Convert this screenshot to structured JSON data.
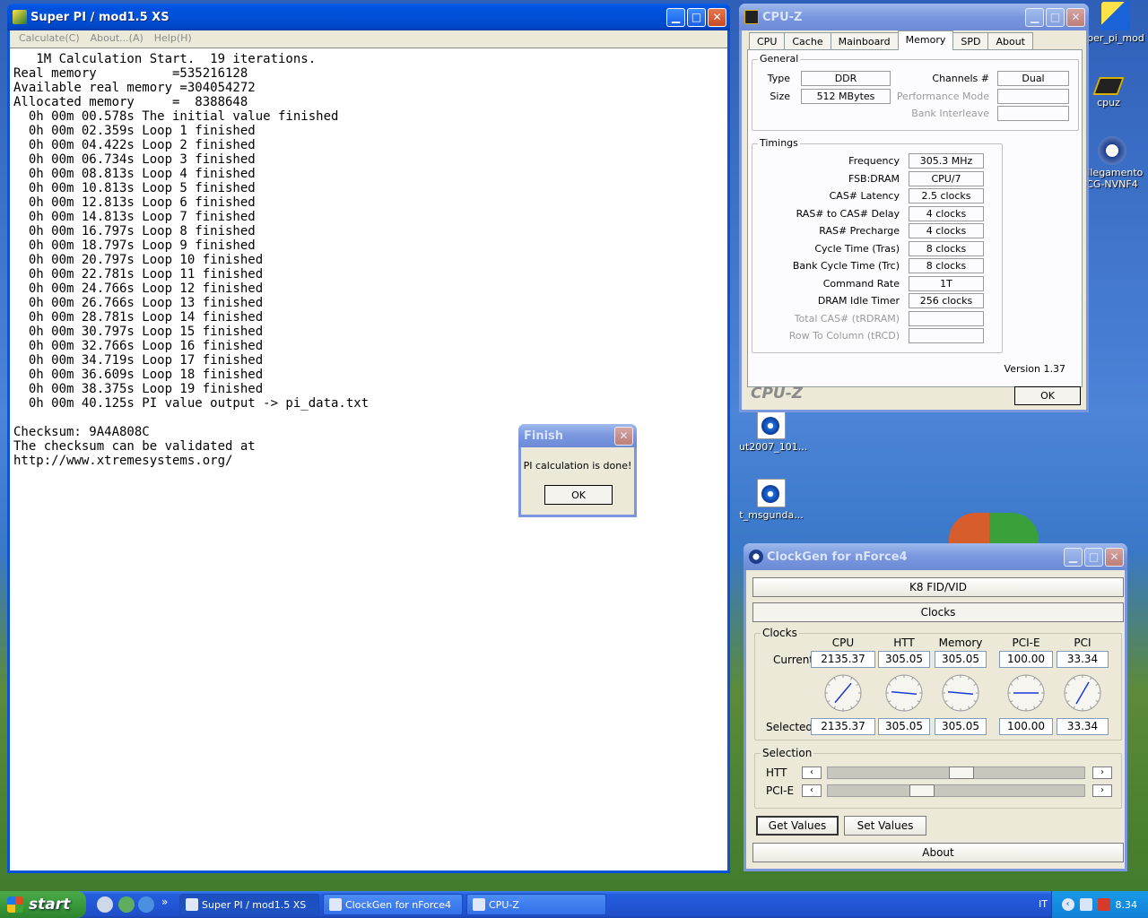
{
  "superpi": {
    "title": "Super PI / mod1.5 XS",
    "menu": [
      "Calculate(C)",
      "About...(A)",
      "Help(H)"
    ],
    "lines": [
      "   1M Calculation Start.  19 iterations.",
      "Real memory          =535216128",
      "Available real memory =304054272",
      "Allocated memory     =  8388648",
      "  0h 00m 00.578s The initial value finished",
      "  0h 00m 02.359s Loop 1 finished",
      "  0h 00m 04.422s Loop 2 finished",
      "  0h 00m 06.734s Loop 3 finished",
      "  0h 00m 08.813s Loop 4 finished",
      "  0h 00m 10.813s Loop 5 finished",
      "  0h 00m 12.813s Loop 6 finished",
      "  0h 00m 14.813s Loop 7 finished",
      "  0h 00m 16.797s Loop 8 finished",
      "  0h 00m 18.797s Loop 9 finished",
      "  0h 00m 20.797s Loop 10 finished",
      "  0h 00m 22.781s Loop 11 finished",
      "  0h 00m 24.766s Loop 12 finished",
      "  0h 00m 26.766s Loop 13 finished",
      "  0h 00m 28.781s Loop 14 finished",
      "  0h 00m 30.797s Loop 15 finished",
      "  0h 00m 32.766s Loop 16 finished",
      "  0h 00m 34.719s Loop 17 finished",
      "  0h 00m 36.609s Loop 18 finished",
      "  0h 00m 38.375s Loop 19 finished",
      "  0h 00m 40.125s PI value output -> pi_data.txt",
      "",
      "Checksum: 9A4A808C",
      "The checksum can be validated at",
      "http://www.xtremesystems.org/"
    ]
  },
  "finish": {
    "title": "Finish",
    "message": "PI calculation is done!",
    "ok": "OK"
  },
  "cpuz": {
    "title": "CPU-Z",
    "tabs": [
      "CPU",
      "Cache",
      "Mainboard",
      "Memory",
      "SPD",
      "About"
    ],
    "active_tab": "Memory",
    "general": {
      "legend": "General",
      "type_label": "Type",
      "type": "DDR",
      "size_label": "Size",
      "size": "512 MBytes",
      "channels_label": "Channels #",
      "channels": "Dual",
      "perf_label": "Performance Mode",
      "bank_label": "Bank Interleave"
    },
    "timings": {
      "legend": "Timings",
      "rows": [
        {
          "label": "Frequency",
          "value": "305.3 MHz",
          "dim": false
        },
        {
          "label": "FSB:DRAM",
          "value": "CPU/7",
          "dim": false
        },
        {
          "label": "CAS# Latency",
          "value": "2.5 clocks",
          "dim": false
        },
        {
          "label": "RAS# to CAS# Delay",
          "value": "4 clocks",
          "dim": false
        },
        {
          "label": "RAS# Precharge",
          "value": "4 clocks",
          "dim": false
        },
        {
          "label": "Cycle Time (Tras)",
          "value": "8 clocks",
          "dim": false
        },
        {
          "label": "Bank Cycle Time (Trc)",
          "value": "8 clocks",
          "dim": false
        },
        {
          "label": "Command Rate",
          "value": "1T",
          "dim": false
        },
        {
          "label": "DRAM Idle Timer",
          "value": "256 clocks",
          "dim": false
        },
        {
          "label": "Total CAS# (tRDRAM)",
          "value": "",
          "dim": true
        },
        {
          "label": "Row To Column (tRCD)",
          "value": "",
          "dim": true
        }
      ]
    },
    "version": "Version 1.37",
    "brand": "CPU-Z",
    "ok": "OK"
  },
  "clockgen": {
    "title": "ClockGen for nForce4",
    "k8_button": "K8 FID/VID",
    "clocks_button": "Clocks",
    "clocks_legend": "Clocks",
    "columns": [
      "CPU",
      "HTT",
      "Memory",
      "PCI-E",
      "PCI"
    ],
    "current_label": "Current",
    "current": [
      "2135.37",
      "305.05",
      "305.05",
      "100.00",
      "33.34"
    ],
    "selected_label": "Selected",
    "selected": [
      "2135.37",
      "305.05",
      "305.05",
      "100.00",
      "33.34"
    ],
    "selection_legend": "Selection",
    "htt_label": "HTT",
    "htt_level": 0.52,
    "pcie_label": "PCI-E",
    "pcie_level": 0.35,
    "get_values": "Get Values",
    "set_values": "Set Values",
    "about": "About"
  },
  "desktop_icons": [
    {
      "label": "per_pi_mod",
      "icon": "superpi-icon"
    },
    {
      "label": "cpuz",
      "icon": "chip-icon"
    },
    {
      "label": "ollegamento CG-NVNF4",
      "icon": "clockgen-shortcut-icon"
    },
    {
      "label": "ut2007_101...",
      "icon": "media-file-icon"
    },
    {
      "label": "t_msgunda...",
      "icon": "media-file-icon"
    }
  ],
  "taskbar": {
    "start": "start",
    "tasks": [
      "Super PI / mod1.5 XS",
      "ClockGen for nForce4",
      "CPU-Z"
    ],
    "language": "IT",
    "clock": "8.34"
  },
  "colors": {
    "xp_blue": "#0a52d6",
    "start_green": "#3a9a3a",
    "window_face": "#ece9d8"
  }
}
